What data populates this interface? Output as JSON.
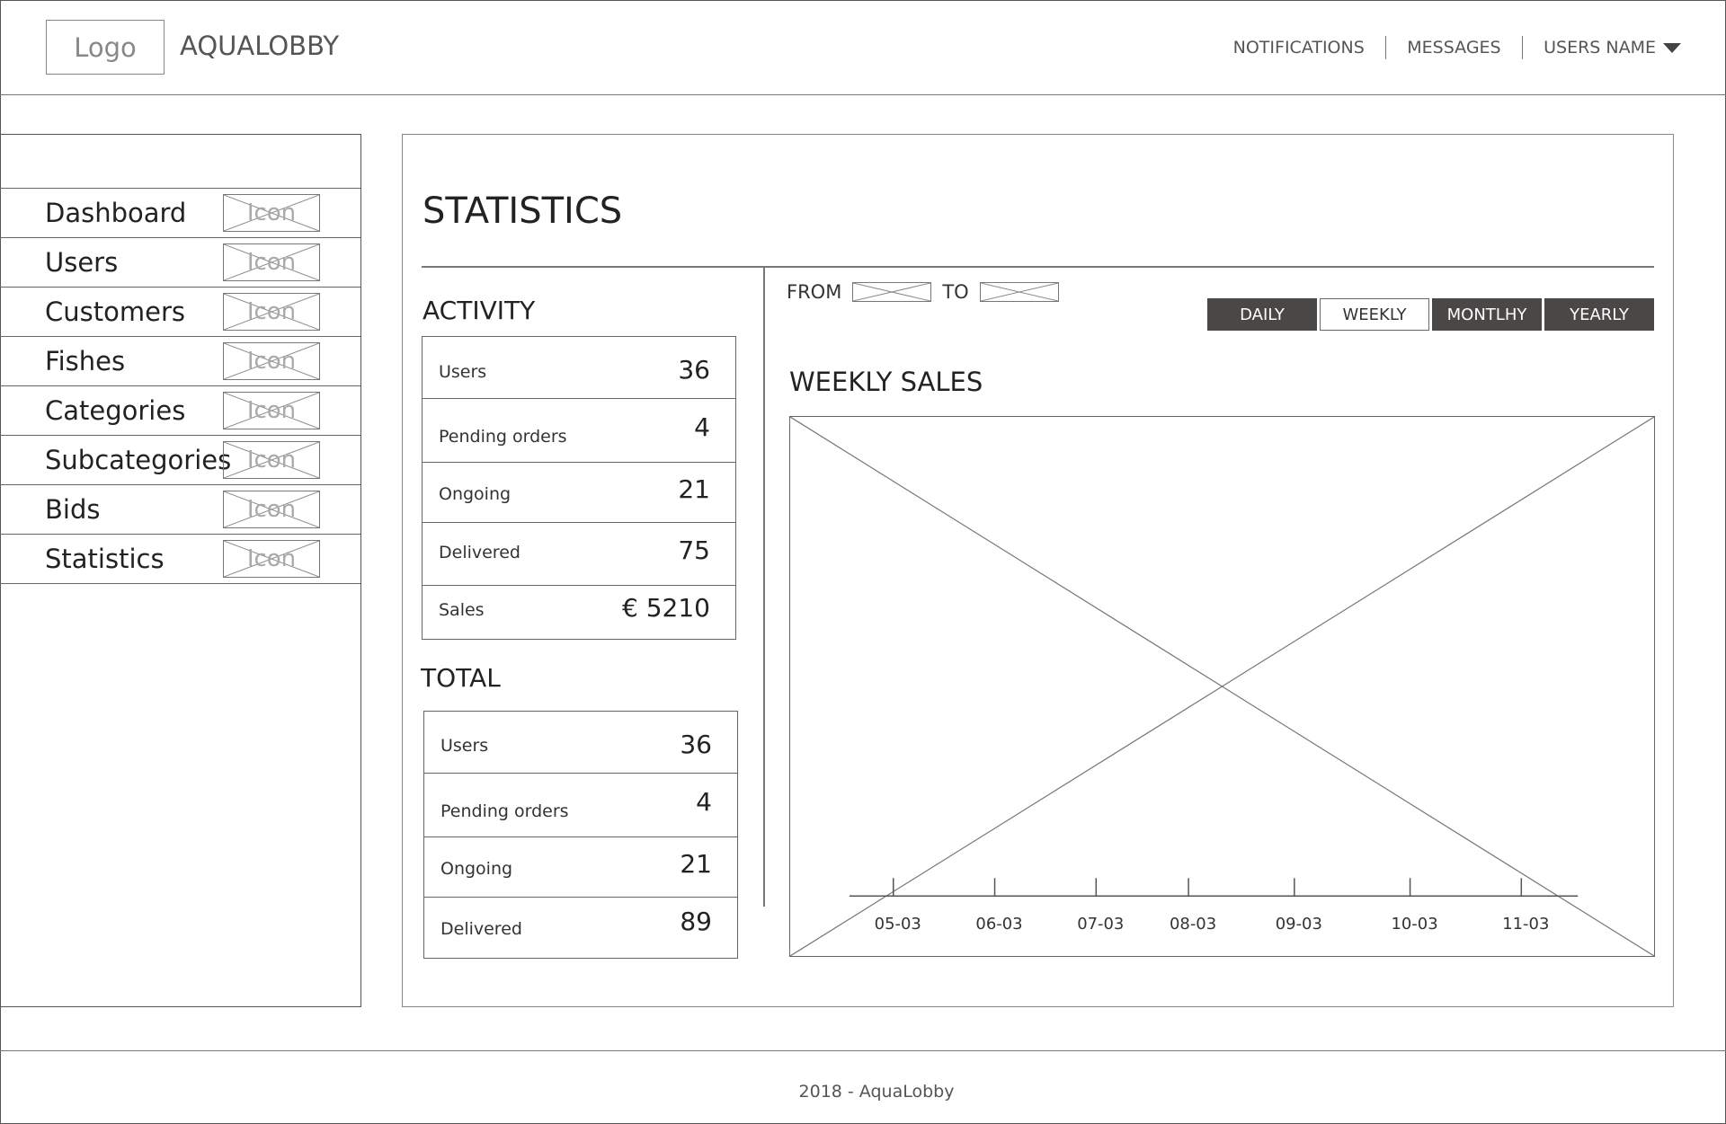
{
  "header": {
    "logo": "Logo",
    "brand": "AQUALOBBY",
    "nav": {
      "notifications": "NOTIFICATIONS",
      "messages": "MESSAGES",
      "user": "USERS NAME"
    }
  },
  "sidebar": {
    "items": [
      {
        "label": "Dashboard",
        "icon": "Icon"
      },
      {
        "label": "Users",
        "icon": "Icon"
      },
      {
        "label": "Customers",
        "icon": "Icon"
      },
      {
        "label": "Fishes",
        "icon": "Icon"
      },
      {
        "label": "Categories",
        "icon": "Icon"
      },
      {
        "label": "Subcategories",
        "icon": "Icon"
      },
      {
        "label": "Bids",
        "icon": "Icon"
      },
      {
        "label": "Statistics",
        "icon": "Icon"
      }
    ]
  },
  "main": {
    "title": "STATISTICS",
    "activity": {
      "title": "ACTIVITY",
      "rows": [
        {
          "label": "Users",
          "value": "36"
        },
        {
          "label": "Pending orders",
          "value": "4"
        },
        {
          "label": "Ongoing",
          "value": "21"
        },
        {
          "label": "Delivered",
          "value": "75"
        },
        {
          "label": "Sales",
          "value": "€ 5210"
        }
      ]
    },
    "total": {
      "title": "TOTAL",
      "rows": [
        {
          "label": "Users",
          "value": "36"
        },
        {
          "label": "Pending orders",
          "value": "4"
        },
        {
          "label": "Ongoing",
          "value": "21"
        },
        {
          "label": "Delivered",
          "value": "89"
        }
      ]
    },
    "range": {
      "from": "FROM",
      "to": "TO"
    },
    "tabs": [
      {
        "label": "DAILY",
        "active": false
      },
      {
        "label": "WEEKLY",
        "active": true
      },
      {
        "label": "MONTLHY",
        "active": false
      },
      {
        "label": "YEARLY",
        "active": false
      }
    ],
    "chart": {
      "title": "WEEKLY SALES",
      "ticks": [
        "05-03",
        "06-03",
        "07-03",
        "08-03",
        "09-03",
        "10-03",
        "11-03"
      ]
    }
  },
  "footer": {
    "text": "2018 - AquaLobby"
  }
}
